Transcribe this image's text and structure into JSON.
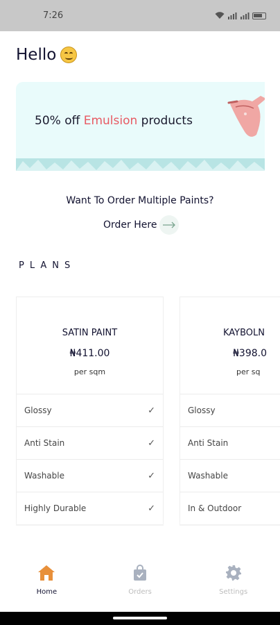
{
  "status_bar": {
    "time": "7:26"
  },
  "greeting": {
    "text": "Hello"
  },
  "banner": {
    "prefix": "50% off ",
    "highlight": "Emulsion",
    "suffix": " products",
    "highlight_color": "#e85a63"
  },
  "cta": {
    "question": "Want To Order Multiple Paints?",
    "link_label": "Order Here"
  },
  "plans": {
    "title": "PLANS",
    "cards": [
      {
        "name": "SATIN PAINT",
        "price": "₦411.00",
        "unit": "per sqm",
        "features": [
          {
            "label": "Glossy",
            "checked": true
          },
          {
            "label": "Anti Stain",
            "checked": true
          },
          {
            "label": "Washable",
            "checked": true
          },
          {
            "label": "Highly Durable",
            "checked": true
          }
        ]
      },
      {
        "name": "KAYBOLN",
        "price": "₦398.0",
        "unit": "per sq",
        "features": [
          {
            "label": "Glossy"
          },
          {
            "label": "Anti Stain"
          },
          {
            "label": "Washable"
          },
          {
            "label": "In & Outdoor"
          }
        ]
      }
    ]
  },
  "tabs": [
    {
      "label": "Home",
      "icon": "home-icon",
      "active": true,
      "color": "#e8903a"
    },
    {
      "label": "Orders",
      "icon": "orders-bag-icon",
      "active": false,
      "color": "#a9b1bf"
    },
    {
      "label": "Settings",
      "icon": "gear-icon",
      "active": false,
      "color": "#a9b1bf"
    }
  ]
}
